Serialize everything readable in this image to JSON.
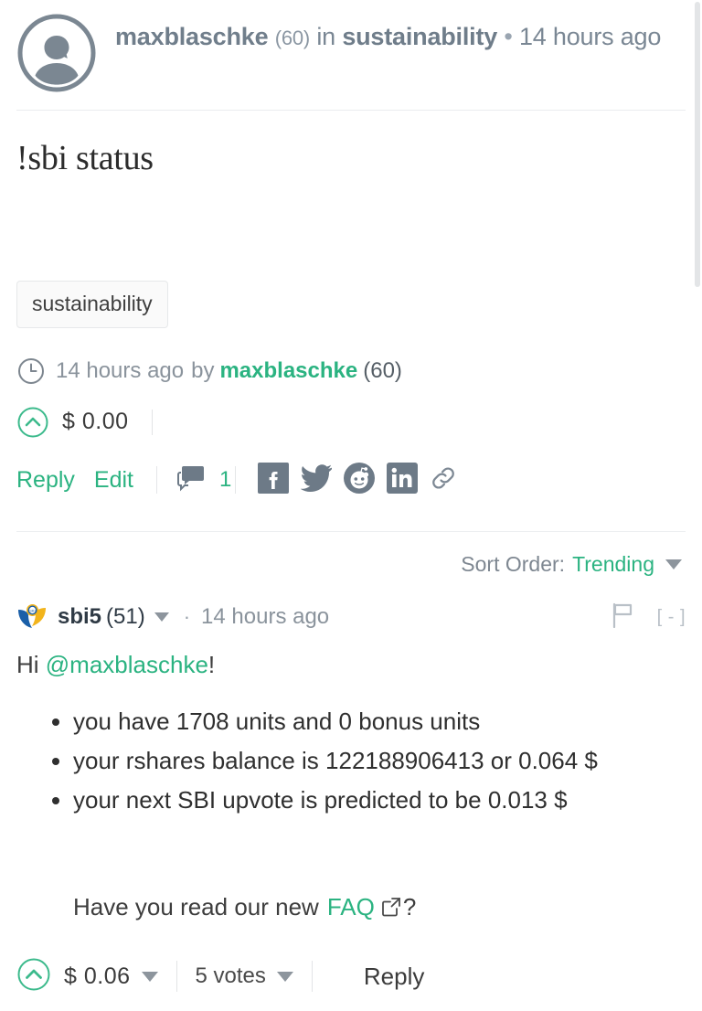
{
  "post": {
    "author": "maxblaschke",
    "author_reputation": "(60)",
    "in_word": "in",
    "community": "sustainability",
    "bullet_sep": "•",
    "age": "14 hours ago",
    "title": "!sbi status",
    "tags": [
      "sustainability"
    ],
    "meta_age": "14 hours ago",
    "meta_by": "by",
    "meta_author": "maxblaschke",
    "meta_reputation": "(60)",
    "payout": "$ 0.00",
    "actions": {
      "reply": "Reply",
      "edit": "Edit",
      "comment_count": "1"
    },
    "share_icons": [
      "facebook-icon",
      "twitter-icon",
      "reddit-icon",
      "linkedin-icon",
      "link-icon"
    ]
  },
  "sort": {
    "label": "Sort Order:",
    "value": "Trending"
  },
  "comment": {
    "author": "sbi5",
    "author_reputation": "(51)",
    "dot": "·",
    "age": "14 hours ago",
    "collapse": "[ - ]",
    "greeting_prefix": "Hi ",
    "greeting_mention": "@maxblaschke",
    "greeting_suffix": "!",
    "bullets": [
      "you have 1708 units and 0 bonus units",
      "your rshares balance is 122188906413 or 0.064 $",
      "your next SBI upvote is predicted to be 0.013 $"
    ],
    "faq_prefix": "Have you read our new",
    "faq_link": "FAQ",
    "faq_suffix": "?",
    "payout": "$ 0.06",
    "votes": "5 votes",
    "reply": "Reply"
  },
  "colors": {
    "accent_green": "#2bb381",
    "muted_gray": "#8a939c",
    "icon_slate": "#6d7a87"
  }
}
